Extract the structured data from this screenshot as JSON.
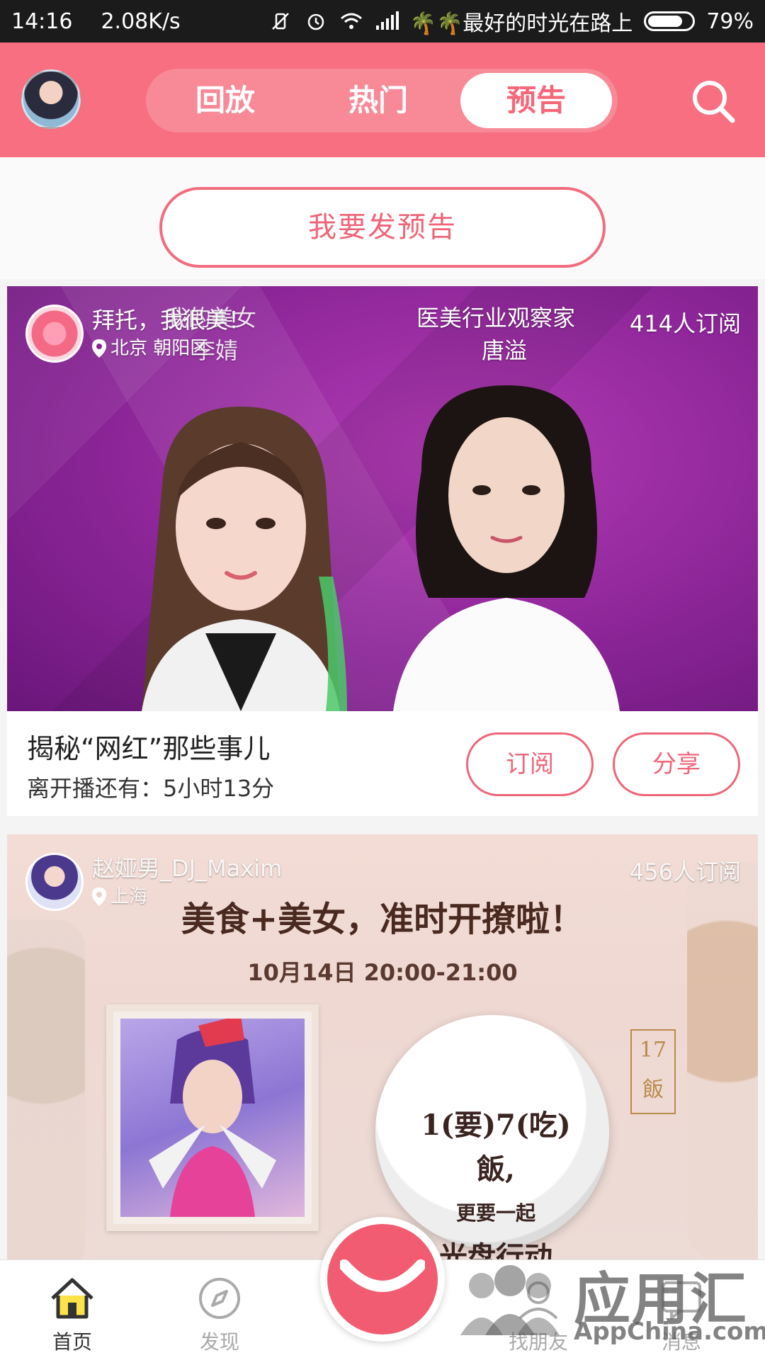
{
  "status_bar": {
    "time": "14:16",
    "net_speed": "2.08K/s",
    "carrier": "🌴🌴最好的时光在路上",
    "battery": "79%",
    "battery_level": 0.79
  },
  "header": {
    "tabs": [
      {
        "label": "回放",
        "active": false
      },
      {
        "label": "热门",
        "active": false
      },
      {
        "label": "预告",
        "active": true
      }
    ]
  },
  "announce_button": "我要发预告",
  "cards": [
    {
      "host_name": "拜托，我很美！",
      "host_location": "北京 朝阳区",
      "cover_text_overlap": "我的美女",
      "cover_text_overlap2": "李婧",
      "cover_guest_title": "医美行业观察家",
      "cover_guest_name": "唐溢",
      "subscribers": "414人订阅",
      "title": "揭秘“网红”那些事儿",
      "countdown": "离开播还有：5小时13分",
      "subscribe_label": "订阅",
      "share_label": "分享"
    },
    {
      "host_name": "赵娅男_DJ_Maxim",
      "host_location": "上海",
      "subscribers": "456人订阅",
      "promo_headline": "美食+美女，准时开撩啦！",
      "promo_time": "10月14日 20:00-21:00",
      "plate_line1": "1(要)7(吃)飯,",
      "plate_line2": "更要一起",
      "plate_line3": "光盘行动",
      "seal_text": "17 飯"
    }
  ],
  "bottom_nav": {
    "home": "首页",
    "discover": "发现",
    "friends": "找朋友",
    "messages": "消息"
  },
  "watermark": {
    "text_cn": "应用汇",
    "text_en": "AppChina.com"
  },
  "colors": {
    "brand": "#f76f80",
    "accent_text": "#ee6679"
  }
}
